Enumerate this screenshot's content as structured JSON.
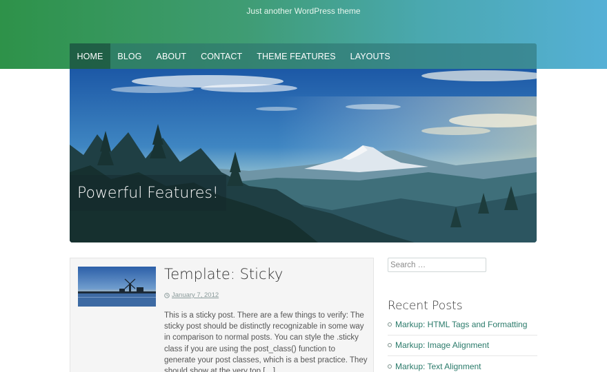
{
  "header": {
    "tagline": "Just another WordPress theme",
    "gradient_colors": [
      "#2e9249",
      "#55b0d6"
    ]
  },
  "nav": {
    "items": [
      {
        "label": "HOME",
        "active": true
      },
      {
        "label": "BLOG"
      },
      {
        "label": "ABOUT"
      },
      {
        "label": "CONTACT"
      },
      {
        "label": "THEME FEATURES"
      },
      {
        "label": "LAYOUTS"
      }
    ]
  },
  "slider": {
    "caption": "Powerful Features!"
  },
  "post": {
    "title": "Template: Sticky",
    "date": "January 7, 2012",
    "excerpt": "This is a sticky post. There are a few things to verify: The sticky post should be distinctly recognizable in some way in comparison to normal posts. You can style the .sticky class if you are using the post_class() function to generate your post classes, which is a best practice. They should show at the very top […]"
  },
  "sidebar": {
    "search_placeholder": "Search …",
    "recent_title": "Recent Posts",
    "recent_posts": [
      "Markup: HTML Tags and Formatting",
      "Markup: Image Alignment",
      "Markup: Text Alignment"
    ],
    "link_color": "#2a7a6a"
  }
}
